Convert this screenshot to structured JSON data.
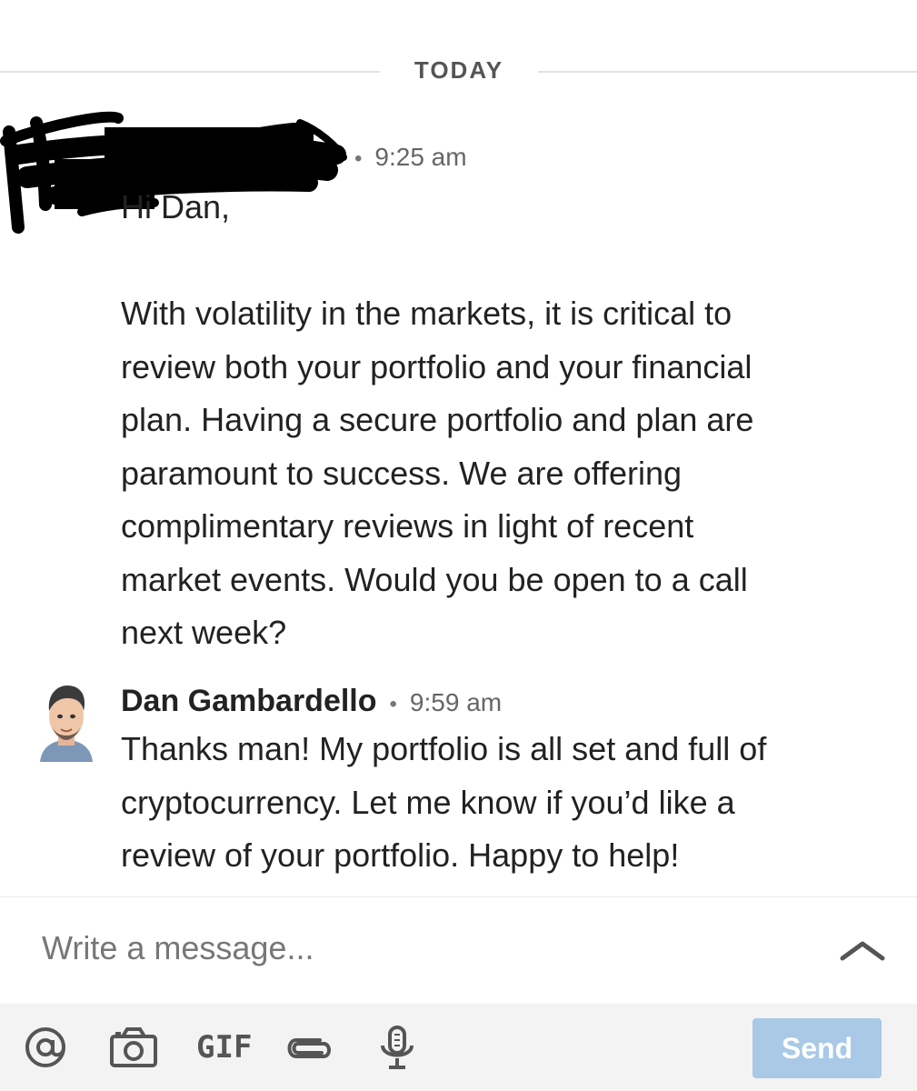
{
  "divider": {
    "label": "TODAY"
  },
  "messages": [
    {
      "sender": "",
      "time": "9:25 am",
      "body": "Hi Dan,\n\nWith volatility in the markets, it is critical to\nreview both your portfolio and your financial\nplan. Having a secure portfolio and plan are\nparamount to success. We are offering\ncomplimentary reviews in light of recent\nmarket events. Would you be open to a call\nnext week?"
    },
    {
      "sender": "Dan Gambardello",
      "time": "9:59 am",
      "body": "Thanks man! My portfolio is all set and full of\ncryptocurrency. Let me know if you’d like a\nreview of your portfolio. Happy to help!"
    }
  ],
  "composer": {
    "placeholder": "Write a message...",
    "expand_icon": "chevron-up-icon"
  },
  "toolbar": {
    "icons": [
      "at-mention-icon",
      "camera-icon",
      "gif-icon",
      "attachment-icon",
      "microphone-icon"
    ],
    "gif_label": "GIF",
    "send_label": "Send"
  },
  "colors": {
    "send_disabled": "#a9c9e6",
    "toolbar_bg": "#f3f3f3"
  }
}
